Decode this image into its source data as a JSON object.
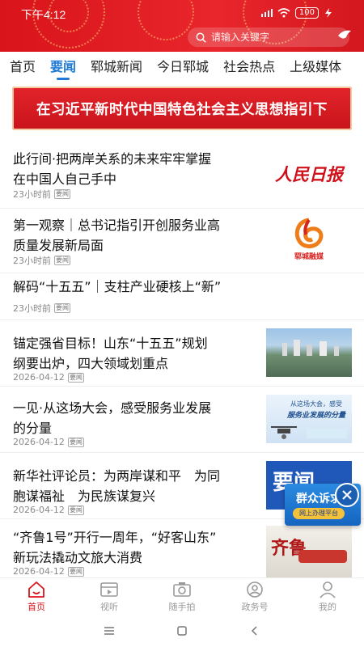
{
  "status_bar": {
    "time": "下午4:12",
    "battery": "100"
  },
  "search": {
    "placeholder": "请输入关键字",
    "icon": "search-icon"
  },
  "tabs": [
    {
      "label": "首页",
      "active": false
    },
    {
      "label": "要闻",
      "active": true
    },
    {
      "label": "郓城新闻",
      "active": false
    },
    {
      "label": "今日郓城",
      "active": false
    },
    {
      "label": "社会热点",
      "active": false
    },
    {
      "label": "上级媒体",
      "active": false
    }
  ],
  "banner": {
    "text": "在习近平新时代中国特色社会主义思想指引下"
  },
  "news": [
    {
      "title_line1": "此行间·把两岸关系的未来牢牢掌握",
      "title_line2": "在中国人自己手中",
      "time": "23小时前",
      "tag": "要闻",
      "thumb_text": "人民日报"
    },
    {
      "title_line1": "第一观察｜总书记指引开创服务业高",
      "title_line2": "质量发展新局面",
      "time": "23小时前",
      "tag": "要闻",
      "thumb_text": "郓城融媒"
    },
    {
      "title_line1": "解码“十五五”｜支柱产业硬核上“新”",
      "time": "23小时前",
      "tag": "要闻"
    },
    {
      "title_line1": "锚定强省目标！山东“十五五”规划",
      "title_line2": "纲要出炉，四大领域划重点",
      "time": "2026-04-12",
      "tag": "要闻"
    },
    {
      "title_line1": "一见·从这场大会，感受服务业发展",
      "title_line2": "的分量",
      "time": "2026-04-12",
      "tag": "要闻",
      "thumb_text1": "从这场大会，感受",
      "thumb_text2": "服务业发展的分量"
    },
    {
      "title_line1": "新华社评论员：为两岸谋和平　为同",
      "title_line2": "胞谋福祉　为民族谋复兴",
      "time": "2026-04-12",
      "tag": "要闻",
      "thumb_text": "要闻"
    },
    {
      "title_line1": "“齐鲁1号”开行一周年，“好客山东”",
      "title_line2": "新玩法撬动文旅大消费",
      "time": "2026-04-12",
      "tag": "要闻",
      "thumb_text": "齐鲁"
    }
  ],
  "float_widget": {
    "title": "群众诉求",
    "subtitle": "网上办理平台"
  },
  "bottom_nav": [
    {
      "label": "首页",
      "icon": "home-icon",
      "active": true
    },
    {
      "label": "视听",
      "icon": "video-icon",
      "active": false
    },
    {
      "label": "随手拍",
      "icon": "camera-icon",
      "active": false
    },
    {
      "label": "政务号",
      "icon": "government-icon",
      "active": false
    },
    {
      "label": "我的",
      "icon": "user-icon",
      "active": false
    }
  ],
  "colors": {
    "header_red": "#d9141b",
    "accent_blue": "#1f7ad6"
  }
}
